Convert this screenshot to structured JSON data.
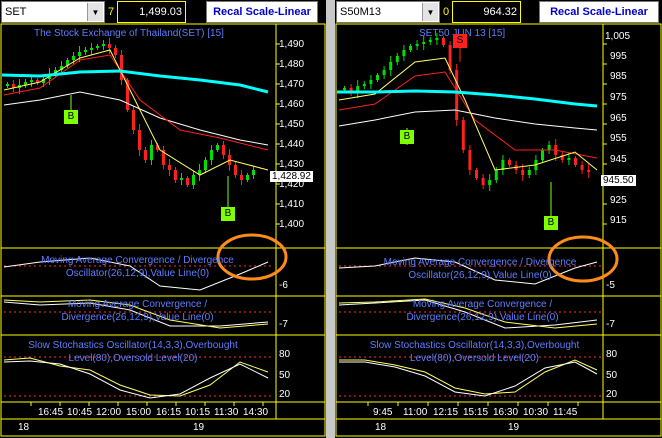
{
  "left": {
    "symbol": "SET",
    "count": "7",
    "price": "1,499.03",
    "recal": "Recal Scale-Linear",
    "title": "The Stock Exchange of Thailand(SET) [15]",
    "y_ticks": [
      "1,490",
      "1,480",
      "1,470",
      "1,460",
      "1,450",
      "1,440",
      "1,430",
      "1,420",
      "1,410",
      "1,400"
    ],
    "last_price": "1,428.92",
    "macd_title": "Moving Average Convergence / Divergence Oscillator(26,12,9),Value Line(0)",
    "macd_ticks": [
      "-6"
    ],
    "macd2_title": "Moving Average Convergence / Divergence(26,12,9),Value Line(0)",
    "macd2_ticks": [
      "-7"
    ],
    "stoch_title": "Slow Stochastics Oscillator(14,3,3),Overbought Level(80),Oversold Level(20)",
    "stoch_ticks": [
      "80",
      "50",
      "20"
    ],
    "times": [
      "16:45",
      "10:45",
      "12:00",
      "15:00",
      "16:15",
      "10:15",
      "11:30",
      "14:30"
    ],
    "dates": [
      "18",
      "19"
    ],
    "signals": [
      "B",
      "B"
    ],
    "colors": {
      "accent": "#00ffff",
      "buy": "#7fff00"
    }
  },
  "right": {
    "symbol": "S50M13",
    "count": "0",
    "price": "964.32",
    "recal": "Recal Scale-Linear",
    "title": "SET50 JUN 13   [15]",
    "y_ticks": [
      "1,005",
      "995",
      "985",
      "975",
      "965",
      "955",
      "945",
      "935",
      "925",
      "915"
    ],
    "last_price": "945.50",
    "macd_title": "Moving Average Convergence / Divergence Oscillator(26,12,9),Value Line(0)",
    "macd_ticks": [
      "-5"
    ],
    "macd2_title": "Moving Average Convergence / Divergence(26,12,9),Value Line(0)",
    "macd2_ticks": [
      "-7"
    ],
    "stoch_title": "Slow Stochastics Oscillator(14,3,3),Overbought Level(80),Oversold Level(20)",
    "stoch_ticks": [
      "80",
      "50",
      "20"
    ],
    "times": [
      "9:45",
      "11:00",
      "12:15",
      "15:15",
      "16:30",
      "10:30",
      "11:45"
    ],
    "dates": [
      "18",
      "19"
    ],
    "signals": [
      "S",
      "B",
      "B"
    ],
    "colors": {
      "accent": "#00ffff",
      "sell": "#ff2020",
      "buy": "#7fff00"
    }
  }
}
